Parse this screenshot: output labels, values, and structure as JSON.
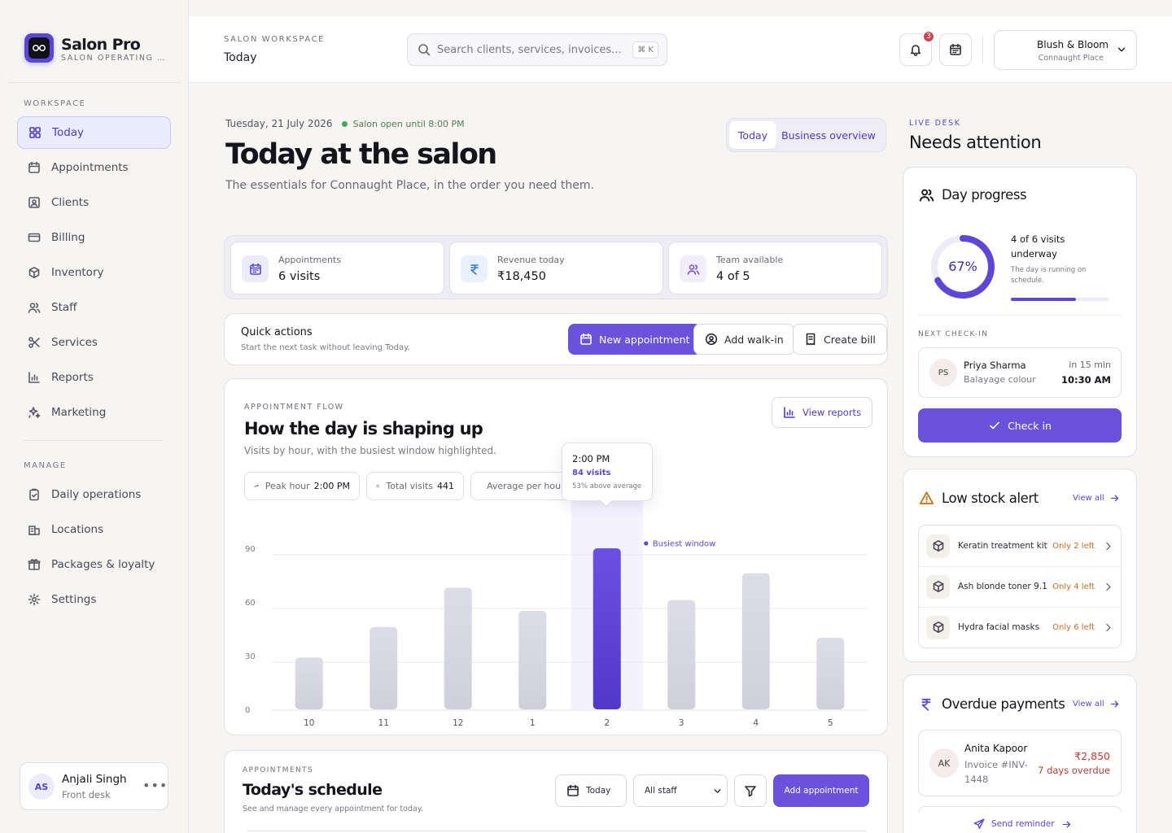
{
  "app": {
    "brand_name": "Salon Pro",
    "brand_sub": "SALON OPERATING SYSTEM",
    "accent": "#6a52dc"
  },
  "sidebar": {
    "workspace_label": "WORKSPACE",
    "workspace_items": [
      {
        "label": "Today",
        "icon": "grid-icon",
        "active": true
      },
      {
        "label": "Appointments",
        "icon": "calendar-icon"
      },
      {
        "label": "Clients",
        "icon": "client-card-icon"
      },
      {
        "label": "Billing",
        "icon": "credit-card-icon"
      },
      {
        "label": "Inventory",
        "icon": "box-icon"
      },
      {
        "label": "Staff",
        "icon": "users-icon"
      },
      {
        "label": "Services",
        "icon": "scissors-icon"
      },
      {
        "label": "Reports",
        "icon": "bar-chart-icon"
      },
      {
        "label": "Marketing",
        "icon": "sparkle-icon"
      }
    ],
    "manage_label": "MANAGE",
    "manage_items": [
      {
        "label": "Daily operations",
        "icon": "clipboard-check-icon"
      },
      {
        "label": "Locations",
        "icon": "building-icon"
      },
      {
        "label": "Packages & loyalty",
        "icon": "gift-icon"
      },
      {
        "label": "Settings",
        "icon": "gear-icon"
      }
    ],
    "user": {
      "initials": "AS",
      "name": "Anjali Singh",
      "role": "Front desk"
    }
  },
  "topbar": {
    "workspace_label": "SALON WORKSPACE",
    "page": "Today",
    "search_placeholder": "Search clients, services, invoices...",
    "shortcut": "⌘ K",
    "notification_count": "3",
    "business": {
      "name": "Blush & Bloom",
      "location": "Connaught Place"
    }
  },
  "header": {
    "date": "Tuesday, 21 July 2026",
    "status": "Salon open until 8:00 PM",
    "title": "Today at the salon",
    "subtitle": "The essentials for Connaught Place, in the order you need them.",
    "tabs": [
      {
        "label": "Today",
        "active": true
      },
      {
        "label": "Business overview"
      }
    ]
  },
  "stats": [
    {
      "label": "Appointments",
      "value": "6 visits",
      "icon": "calendar-icon"
    },
    {
      "label": "Revenue today",
      "value": "₹18,450",
      "icon": "rupee-icon"
    },
    {
      "label": "Team available",
      "value": "4 of 5",
      "icon": "users-icon"
    }
  ],
  "quick_actions": {
    "title": "Quick actions",
    "subtitle": "Start the next task without leaving Today.",
    "new_appointment": "New appointment",
    "add_walkin": "Add walk-in",
    "create_bill": "Create bill"
  },
  "flow": {
    "eyebrow": "APPOINTMENT FLOW",
    "title": "How the day is shaping up",
    "subtitle": "Visits by hour, with the busiest window highlighted.",
    "view_reports": "View reports",
    "chips": [
      {
        "label": "Peak hour",
        "value": "2:00 PM"
      },
      {
        "label": "Total visits",
        "value": "441"
      },
      {
        "label": "Average per hour",
        "value": ""
      }
    ],
    "tooltip": {
      "time": "2:00 PM",
      "visits": "84 visits",
      "note": "53% above average"
    },
    "busiest_label": "Busiest window"
  },
  "chart_data": {
    "type": "bar",
    "categories": [
      "10",
      "11",
      "12",
      "1",
      "2",
      "3",
      "4",
      "5"
    ],
    "values": [
      29,
      46,
      68,
      55,
      90,
      61,
      76,
      40
    ],
    "highlight_index": 4,
    "yticks": [
      0,
      30,
      60,
      90
    ],
    "ylim": [
      0,
      100
    ],
    "bar_color": "#d5d6e1",
    "highlight_color": "#5f45d8"
  },
  "schedule": {
    "eyebrow": "APPOINTMENTS",
    "title": "Today's schedule",
    "subtitle": "See and manage every appointment for today.",
    "date_btn": "Today",
    "staff_select": "All staff",
    "add": "Add appointment"
  },
  "rail": {
    "label": "LIVE DESK",
    "title": "Needs attention",
    "progress": {
      "title": "Day progress",
      "percent": "67%",
      "fraction": 0.67,
      "visits": "4 of 6 visits underway",
      "note": "The day is running on schedule.",
      "bar_fraction": 0.67
    },
    "next": {
      "label": "NEXT CHECK-IN",
      "initials": "PS",
      "name": "Priya Sharma",
      "service": "Balayage colour",
      "eta": "in 15 min",
      "time": "10:30 AM",
      "checkin": "Check in"
    },
    "stock": {
      "title": "Low stock alert",
      "view_all": "View all",
      "items": [
        {
          "name": "Keratin treatment kit",
          "left": "Only 2 left"
        },
        {
          "name": "Ash blonde toner 9.1",
          "left": "Only 4 left"
        },
        {
          "name": "Hydra facial masks",
          "left": "Only 6 left"
        }
      ]
    },
    "overdue": {
      "title": "Overdue payments",
      "view_all": "View all",
      "initials": "AK",
      "name": "Anita Kapoor",
      "invoice": "Invoice #INV-1448",
      "amount": "₹2,850",
      "days": "7 days overdue",
      "reminder": "Send reminder"
    }
  }
}
